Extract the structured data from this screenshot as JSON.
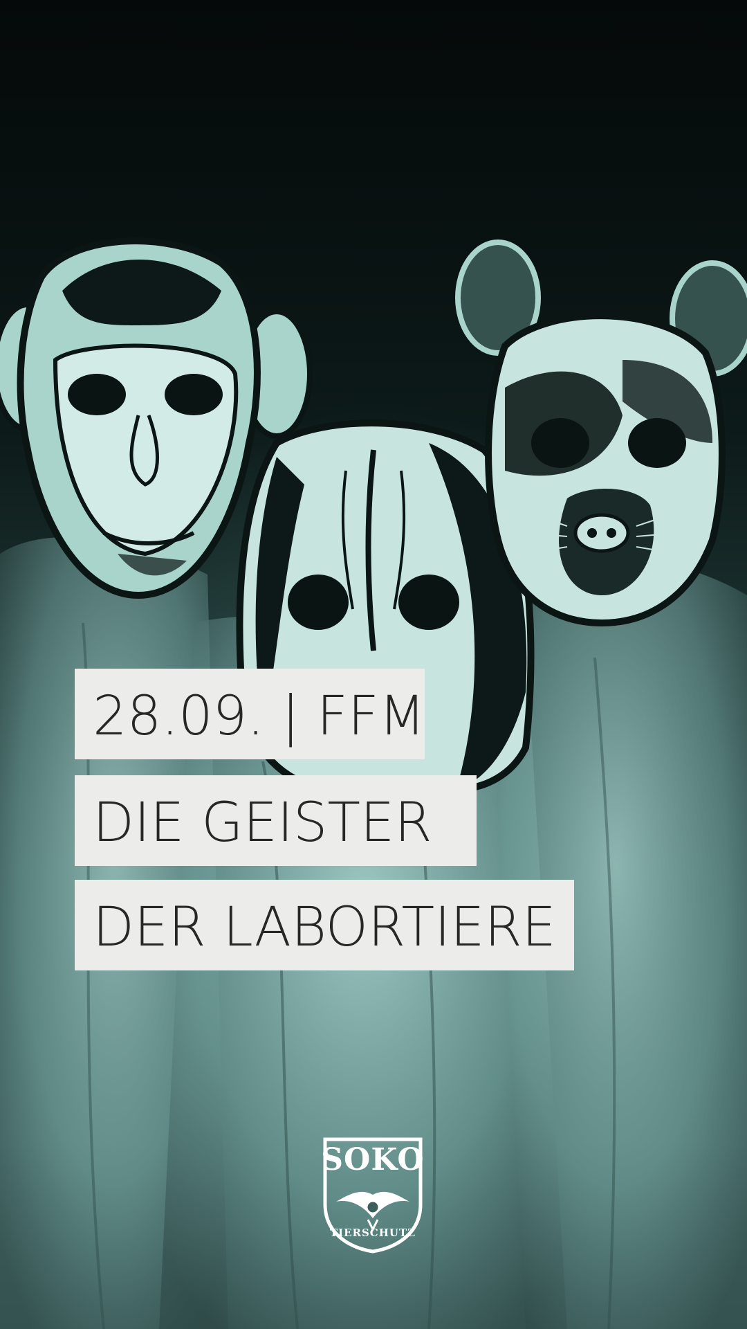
{
  "event": {
    "date_location": "28.09. | FFM",
    "title_line1": "DIE GEISTER",
    "title_line2": "DER LABORTIERE"
  },
  "logo": {
    "name": "SOKO",
    "subtitle": "TIERSCHUTZ",
    "icon": "owl-emblem-icon"
  },
  "colors": {
    "label_background": "#ecedeb",
    "label_text": "#272727",
    "tint": "#7fb3ad",
    "background_dark": "#07100f"
  }
}
